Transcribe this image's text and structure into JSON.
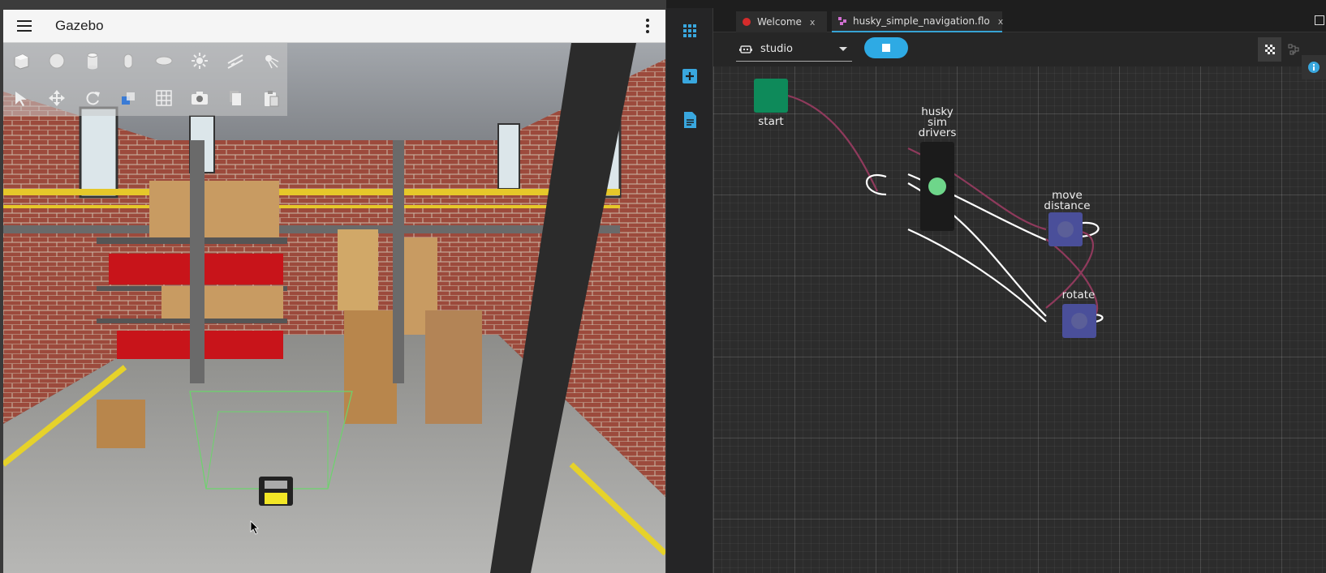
{
  "gazebo": {
    "title": "Gazebo",
    "menu_icon": "hamburger-menu-icon",
    "more_icon": "more-vert-icon",
    "toolbar_row1": [
      "box-shape-icon",
      "sphere-shape-icon",
      "cylinder-shape-icon",
      "capsule-shape-icon",
      "ellipsoid-shape-icon",
      "sun-light-icon",
      "directional-light-icon",
      "spot-light-icon"
    ],
    "toolbar_row2": [
      "select-arrow-icon",
      "translate-icon",
      "rotate-icon",
      "snap-icon",
      "grid-icon",
      "screenshot-camera-icon",
      "copy-icon",
      "paste-icon"
    ]
  },
  "flow": {
    "tabs": [
      {
        "label": "Welcome",
        "close": "x",
        "icon": "ros-logo-icon"
      },
      {
        "label": "husky_simple_navigation.flo",
        "close": "x",
        "icon": "flow-file-icon"
      }
    ],
    "activity_bar": [
      "apps-grid-icon",
      "add-node-icon",
      "document-icon"
    ],
    "target": "studio",
    "target_icon": "robot-icon",
    "stop_icon": "stop-icon",
    "view_toggle": [
      "grid-view-icon",
      "graph-view-icon"
    ],
    "info_icon": "info-icon",
    "nodes": {
      "start": "start",
      "drivers": [
        "husky",
        "sim",
        "drivers"
      ],
      "move": [
        "move",
        "distance"
      ],
      "rotate": "rotate"
    },
    "colors": {
      "start_node": "#0e8a5a",
      "driver_node": "#1b1b1b",
      "driver_status": "#6ed68a",
      "action_node": "#4a4f9a",
      "edge_red": "#8f3a5c",
      "edge_white": "#ffffff",
      "accent": "#2eaae4"
    }
  }
}
